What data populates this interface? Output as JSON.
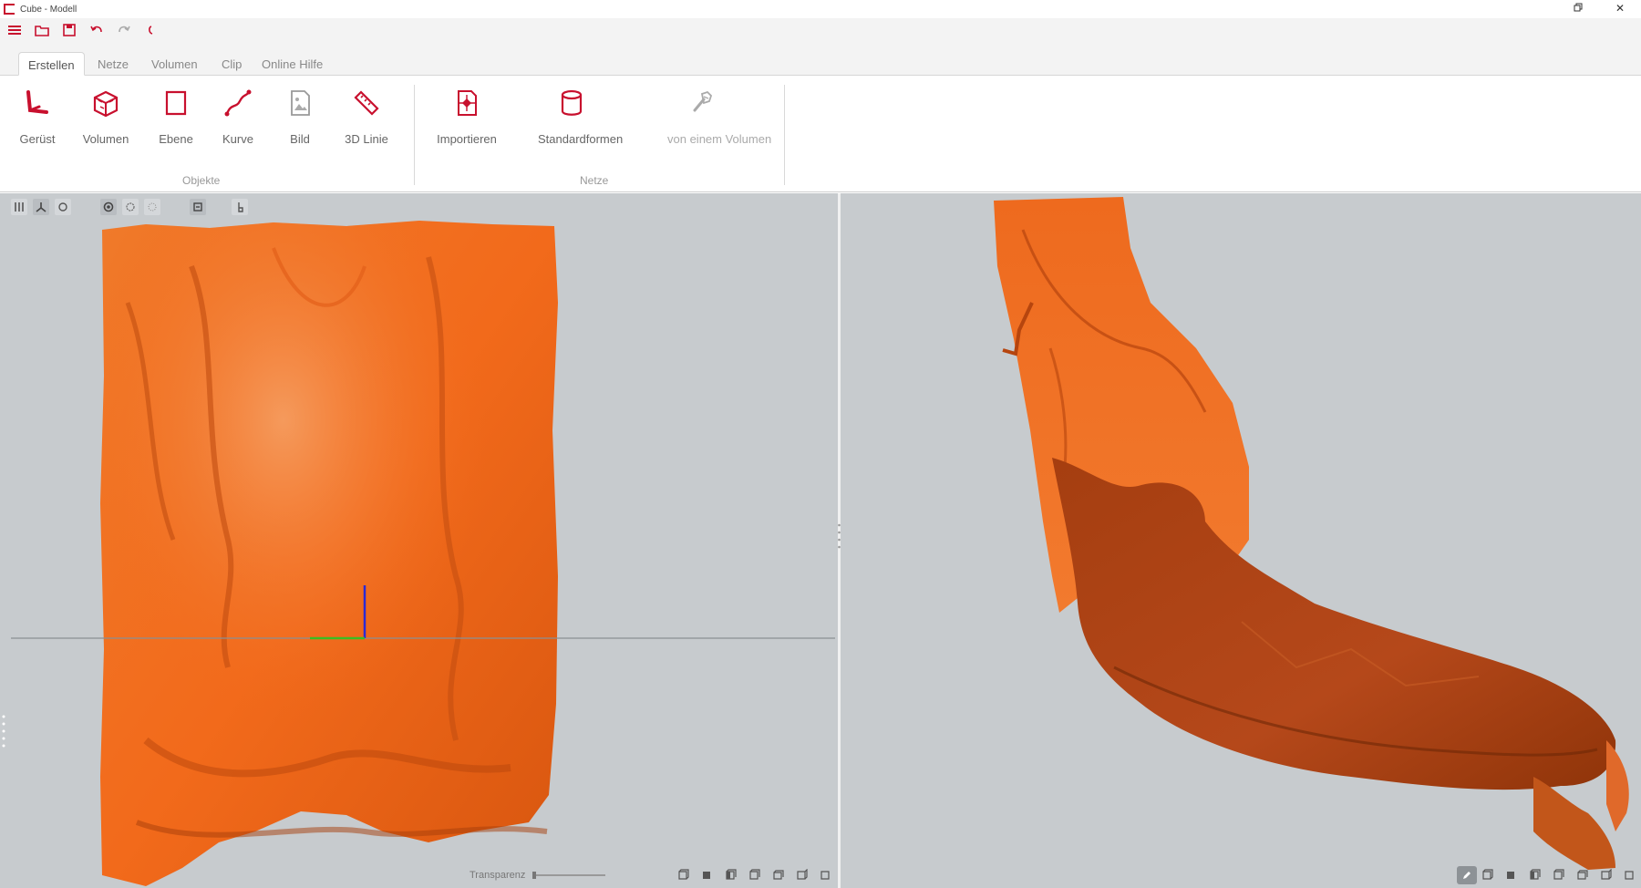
{
  "window": {
    "title": "Cube - Modell",
    "restore_icon": "restore-icon",
    "close_label": "✕"
  },
  "quickbar": {
    "icons": [
      "menu-icon",
      "open-folder-icon",
      "save-icon",
      "undo-icon",
      "redo-icon",
      "refresh-icon"
    ]
  },
  "tabs": [
    {
      "label": "Erstellen",
      "active": true
    },
    {
      "label": "Netze",
      "active": false
    },
    {
      "label": "Volumen",
      "active": false
    },
    {
      "label": "Clip",
      "active": false
    },
    {
      "label": "Online Hilfe",
      "active": false
    }
  ],
  "ribbon": {
    "groups": [
      {
        "label": "Objekte",
        "buttons": [
          {
            "label": "Gerüst",
            "icon": "skeleton-icon"
          },
          {
            "label": "Volumen",
            "icon": "volume-icon"
          },
          {
            "label": "Ebene",
            "icon": "plane-icon"
          },
          {
            "label": "Kurve",
            "icon": "curve-icon"
          },
          {
            "label": "Bild",
            "icon": "image-icon"
          },
          {
            "label": "3D Linie",
            "icon": "ruler-icon"
          }
        ]
      },
      {
        "label": "Netze",
        "buttons": [
          {
            "label": "Importieren",
            "icon": "import-icon"
          },
          {
            "label": "Standardformen",
            "icon": "cylinder-icon"
          },
          {
            "label": "von einem Volumen",
            "icon": "mesh-from-volume-icon",
            "disabled": true
          }
        ]
      }
    ]
  },
  "viewport_left": {
    "toolbar_icons": [
      "layout-grid-icon",
      "layout-split-icon",
      "sphere-icon",
      "render-solid-icon",
      "render-points-icon",
      "render-wire-icon",
      "clip-icon",
      "cursor-icon"
    ],
    "transparency_label": "Transparenz",
    "bottom_icons": [
      "view-front-icon",
      "view-back-icon",
      "view-left-icon",
      "view-right-icon",
      "view-top-icon",
      "view-bottom-icon",
      "view-iso-icon"
    ]
  },
  "viewport_right": {
    "edit_icon": "pencil-icon",
    "bottom_icons": [
      "view-front-icon",
      "view-back-icon",
      "view-left-icon",
      "view-right-icon",
      "view-top-icon",
      "view-bottom-icon",
      "view-iso-icon"
    ]
  },
  "colors": {
    "accent": "#c8102e",
    "mesh": "#f26a1b",
    "mesh_dark": "#b84312",
    "viewport_bg": "#c7cbce"
  }
}
